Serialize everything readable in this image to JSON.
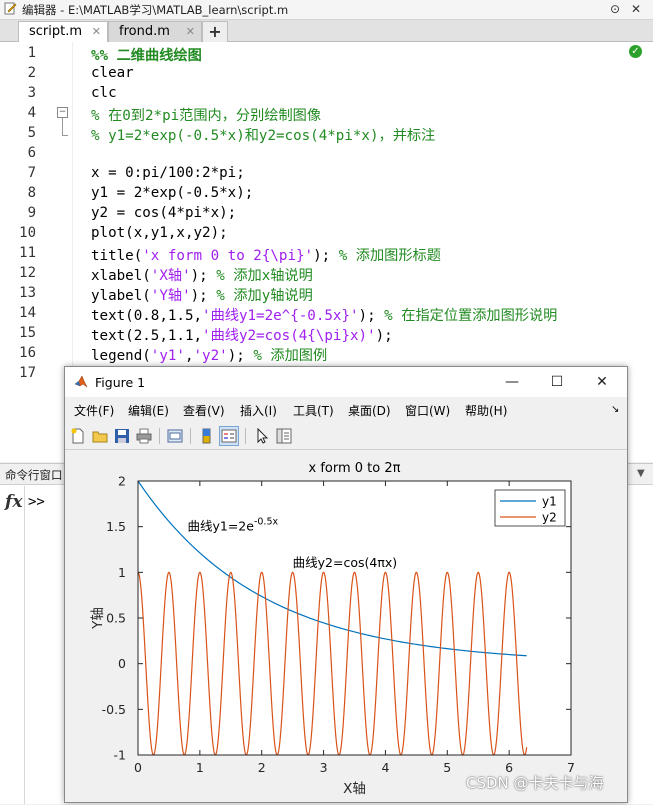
{
  "editor": {
    "title": "编辑器 - E:\\MATLAB学习\\MATLAB_learn\\script.m",
    "tabs": [
      {
        "label": "script.m",
        "close": "✕"
      },
      {
        "label": "frond.m",
        "close": "✕"
      }
    ],
    "add_tab": "+",
    "window_buttons": {
      "options": "⊙",
      "close": "✕"
    },
    "line_numbers": [
      "1",
      "2",
      "3",
      "4",
      "5",
      "6",
      "7",
      "8",
      "9",
      "10",
      "11",
      "12",
      "13",
      "14",
      "15",
      "16",
      "17"
    ],
    "code_lines": [
      [
        {
          "t": "%% 二维曲线绘图",
          "c": "cmb"
        }
      ],
      [
        {
          "t": "clear",
          "c": ""
        }
      ],
      [
        {
          "t": "clc",
          "c": ""
        }
      ],
      [
        {
          "t": "% 在0到2*pi范围内，分别绘制图像",
          "c": "cm"
        }
      ],
      [
        {
          "t": "% y1=2*exp(-0.5*x)和y2=cos(4*pi*x)，并标注",
          "c": "cm"
        }
      ],
      [],
      [
        {
          "t": "x = 0:pi/100:2*pi;",
          "c": ""
        }
      ],
      [
        {
          "t": "y1 = 2*exp(-0.5*x);",
          "c": ""
        }
      ],
      [
        {
          "t": "y2 = cos(4*pi*x);",
          "c": ""
        }
      ],
      [
        {
          "t": "plot(x,y1,x,y2);",
          "c": ""
        }
      ],
      [
        {
          "t": "title(",
          "c": ""
        },
        {
          "t": "'x form 0 to 2{\\pi}'",
          "c": "st"
        },
        {
          "t": "); ",
          "c": ""
        },
        {
          "t": "% 添加图形标题",
          "c": "cm"
        }
      ],
      [
        {
          "t": "xlabel(",
          "c": ""
        },
        {
          "t": "'X轴'",
          "c": "st"
        },
        {
          "t": "); ",
          "c": ""
        },
        {
          "t": "% 添加x轴说明",
          "c": "cm"
        }
      ],
      [
        {
          "t": "ylabel(",
          "c": ""
        },
        {
          "t": "'Y轴'",
          "c": "st"
        },
        {
          "t": "); ",
          "c": ""
        },
        {
          "t": "% 添加y轴说明",
          "c": "cm"
        }
      ],
      [
        {
          "t": "text(0.8,1.5,",
          "c": ""
        },
        {
          "t": "'曲线y1=2e^{-0.5x}'",
          "c": "st"
        },
        {
          "t": "); ",
          "c": ""
        },
        {
          "t": "% 在指定位置添加图形说明",
          "c": "cm"
        }
      ],
      [
        {
          "t": "text(2.5,1.1,",
          "c": ""
        },
        {
          "t": "'曲线y2=cos(4{\\pi}x)'",
          "c": "st"
        },
        {
          "t": ");",
          "c": ""
        }
      ],
      [
        {
          "t": "legend(",
          "c": ""
        },
        {
          "t": "'y1'",
          "c": "st"
        },
        {
          "t": ",",
          "c": ""
        },
        {
          "t": "'y2'",
          "c": "st"
        },
        {
          "t": "); ",
          "c": ""
        },
        {
          "t": "% 添加图例",
          "c": "cm"
        }
      ],
      []
    ]
  },
  "command_window": {
    "title": "命令行窗口",
    "fx": "fx",
    "prompt": ">>"
  },
  "figure": {
    "title": "Figure 1",
    "window_buttons": {
      "minimize": "—",
      "maximize": "☐",
      "close": "✕"
    },
    "menu": [
      "文件(F)",
      "编辑(E)",
      "查看(V)",
      "插入(I)",
      "工具(T)",
      "桌面(D)",
      "窗口(W)",
      "帮助(H)"
    ],
    "menu_more": "↘"
  },
  "chart_data": {
    "type": "line",
    "title": "x form 0 to 2π",
    "xlabel": "X轴",
    "ylabel": "Y轴",
    "xlim": [
      0,
      7
    ],
    "ylim": [
      -1,
      2
    ],
    "xticks": [
      "0",
      "1",
      "2",
      "3",
      "4",
      "5",
      "6",
      "7"
    ],
    "yticks": [
      "-1",
      "-0.5",
      "0",
      "0.5",
      "1",
      "1.5",
      "2"
    ],
    "x_range": [
      0,
      6.2832
    ],
    "series": [
      {
        "name": "y1",
        "formula": "2*exp(-0.5*x)",
        "color": "#0072BD"
      },
      {
        "name": "y2",
        "formula": "cos(4*pi*x)",
        "color": "#D95319"
      }
    ],
    "annotations": [
      {
        "text": "曲线y1=2e",
        "sup": "-0.5x",
        "x": 0.8,
        "y": 1.5
      },
      {
        "text": "曲线y2=cos(4πx)",
        "x": 2.5,
        "y": 1.1
      }
    ],
    "legend_position": "top-right",
    "grid": false
  },
  "watermark": "CSDN @卡夫卡与海"
}
